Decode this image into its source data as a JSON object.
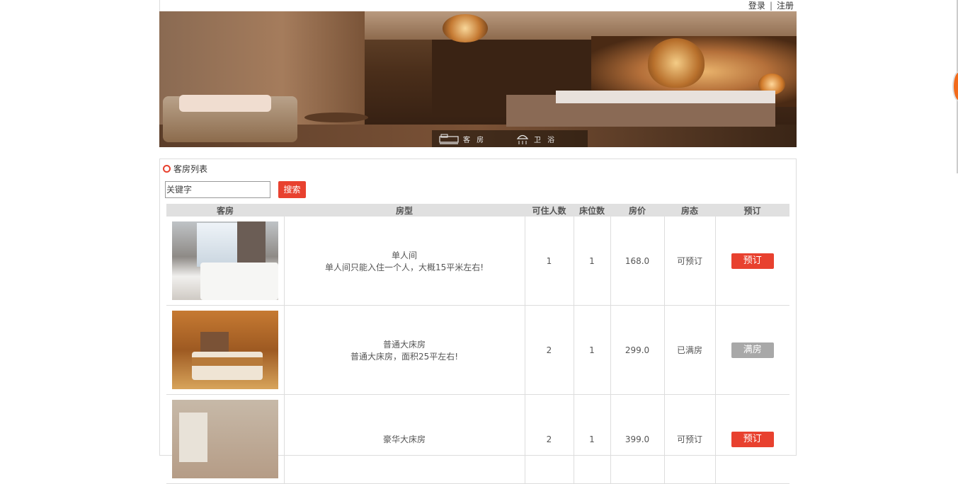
{
  "header": {
    "login": "登录",
    "separator": "|",
    "register": "注册"
  },
  "banner": {
    "nav": [
      {
        "label": "客 房",
        "icon": "bed-icon"
      },
      {
        "label": "卫 浴",
        "icon": "shower-icon"
      }
    ]
  },
  "panel": {
    "title": "客房列表",
    "search_placeholder": "关键字",
    "search_button": "搜索"
  },
  "table": {
    "headers": [
      "客房",
      "房型",
      "可住人数",
      "床位数",
      "房价",
      "房态",
      "预订"
    ],
    "rows": [
      {
        "type_name": "单人间",
        "description": "单人间只能入住一个人，大概15平米左右!",
        "capacity": "1",
        "beds": "1",
        "price": "168.0",
        "status": "可预订",
        "action": "预订",
        "available": true
      },
      {
        "type_name": "普通大床房",
        "description": "普通大床房，面积25平左右!",
        "capacity": "2",
        "beds": "1",
        "price": "299.0",
        "status": "已满房",
        "action": "满房",
        "available": false
      },
      {
        "type_name": "豪华大床房",
        "description": "",
        "capacity": "2",
        "beds": "1",
        "price": "399.0",
        "status": "可预订",
        "action": "预订",
        "available": true
      }
    ]
  },
  "colors": {
    "accent": "#e8412f",
    "disabled": "#a8a8a8",
    "header_bg": "#e0e0e0"
  }
}
